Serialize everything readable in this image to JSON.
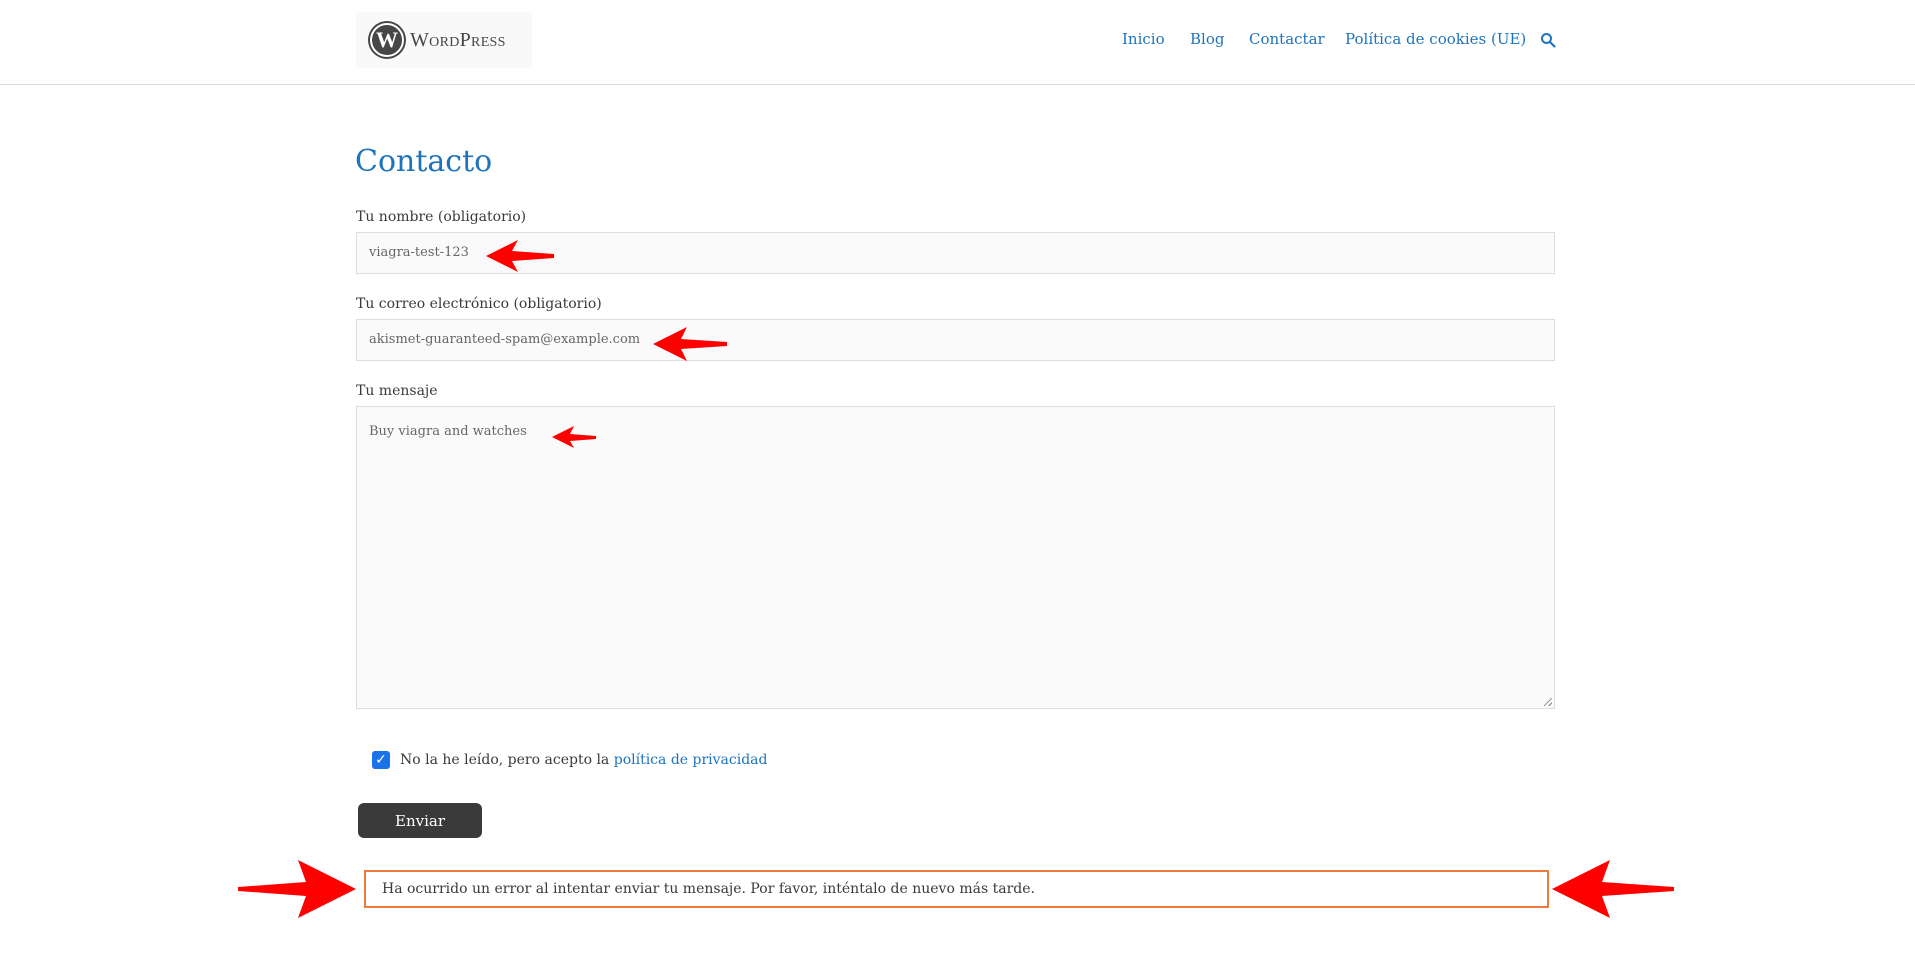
{
  "header": {
    "logo_mark": "W",
    "logo_text": "WordPress",
    "nav": [
      {
        "label": "Inicio"
      },
      {
        "label": "Blog"
      },
      {
        "label": "Contactar"
      },
      {
        "label": "Política de cookies (UE)"
      }
    ],
    "search_icon": "search-icon"
  },
  "page": {
    "title": "Contacto"
  },
  "form": {
    "name_label": "Tu nombre (obligatorio)",
    "name_value": "viagra-test-123",
    "email_label": "Tu correo electrónico (obligatorio)",
    "email_value": "akismet-guaranteed-spam@example.com",
    "message_label": "Tu mensaje",
    "message_value": "Buy viagra and watches",
    "consent_text": "No la he leído, pero acepto la",
    "consent_link": "política de privacidad",
    "consent_checked": true,
    "submit_label": "Enviar",
    "error_message": "Ha ocurrido un error al intentar enviar tu mensaje. Por favor, inténtalo de nuevo más tarde."
  },
  "colors": {
    "link": "#1e73be",
    "annotation_arrow": "#ff0000",
    "error_border": "#f07a3a",
    "button_bg": "#3a3a3a"
  }
}
